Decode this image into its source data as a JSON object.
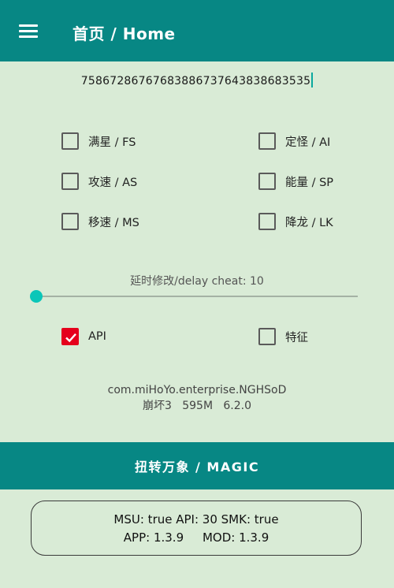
{
  "appbar": {
    "title": "首页 / Home",
    "menu_icon": "menu-icon"
  },
  "code_input": {
    "value": "7586728676768388673764383868353​5"
  },
  "options": {
    "fs": {
      "label": "满星 / FS",
      "checked": false
    },
    "ai": {
      "label": "定怪 / AI",
      "checked": false
    },
    "as": {
      "label": "攻速 / AS",
      "checked": false
    },
    "sp": {
      "label": "能量 / SP",
      "checked": false
    },
    "ms": {
      "label": "移速 / MS",
      "checked": false
    },
    "lk": {
      "label": "降龙 / LK",
      "checked": false
    }
  },
  "delay": {
    "label": "延时修改/delay cheat: 10",
    "value": 10
  },
  "toggles": {
    "api": {
      "label": "API",
      "checked": true
    },
    "feature": {
      "label": "特征",
      "checked": false
    }
  },
  "package": {
    "name": "com.miHoYo.enterprise.NGHSoD",
    "info": "崩坏3   595M   6.2.0"
  },
  "magic_button": {
    "label": "扭转万象 / MAGIC"
  },
  "status": {
    "line1": "MSU: true API: 30 SMK: true",
    "line2": "APP: 1.3.9     MOD: 1.3.9"
  },
  "colors": {
    "primary": "#078784",
    "background": "#d9ebd6",
    "checked": "#e5001c",
    "slider": "#0bc6b8"
  }
}
